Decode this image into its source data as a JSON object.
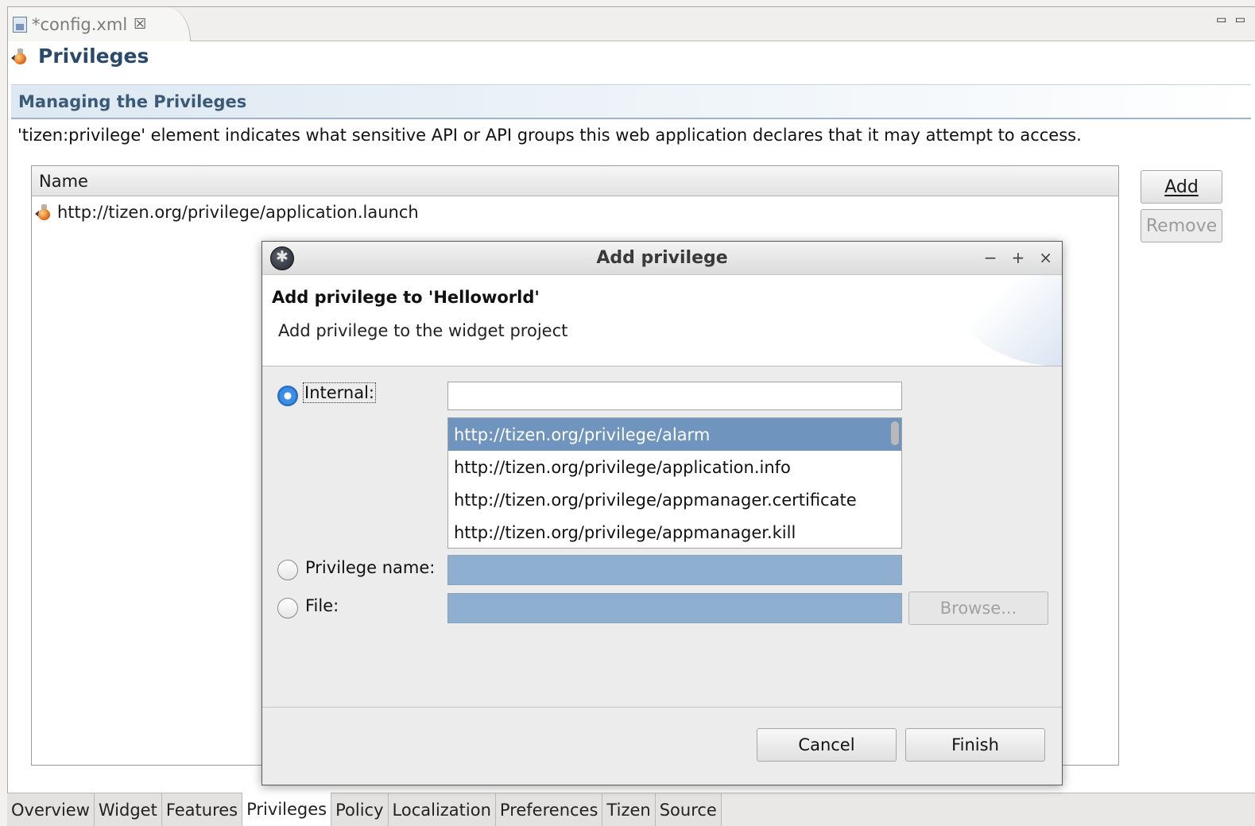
{
  "editor": {
    "tab_label": "*config.xml",
    "tab_close": "☒",
    "window_controls": "▭ ▭"
  },
  "page": {
    "title": "Privileges",
    "section_title": "Managing the Privileges",
    "description": "'tizen:privilege' element indicates what sensitive API or API groups this web application declares that it may attempt to access."
  },
  "table": {
    "header": "Name",
    "rows": [
      {
        "name": "http://tizen.org/privilege/application.launch"
      }
    ]
  },
  "side_buttons": {
    "add": "Add",
    "remove": "Remove"
  },
  "dialog": {
    "title": "Add privilege",
    "controls": {
      "minimize": "−",
      "maximize": "+",
      "close": "×"
    },
    "heading": "Add privilege to 'Helloworld'",
    "subheading": "Add privilege to the widget project",
    "internal_label": "Internal:",
    "internal_input_value": "",
    "list_items": [
      "http://tizen.org/privilege/alarm",
      "http://tizen.org/privilege/application.info",
      "http://tizen.org/privilege/appmanager.certificate",
      "http://tizen.org/privilege/appmanager.kill"
    ],
    "selected_item": "http://tizen.org/privilege/alarm",
    "privilege_name_label": "Privilege name:",
    "file_label": "File:",
    "browse_label": "Browse...",
    "cancel_label": "Cancel",
    "finish_label": "Finish",
    "selected_option": "Internal"
  },
  "bottom_tabs": [
    {
      "label": "Overview"
    },
    {
      "label": "Widget"
    },
    {
      "label": "Features"
    },
    {
      "label": "Privileges",
      "active": true
    },
    {
      "label": "Policy"
    },
    {
      "label": "Localization"
    },
    {
      "label": "Preferences"
    },
    {
      "label": "Tizen"
    },
    {
      "label": "Source"
    }
  ],
  "colors": {
    "title_text": "#2b4a6b",
    "selection": "#6f94bd",
    "disabled_field": "#8eafcf",
    "radio_checked": "#3a8ee6"
  }
}
